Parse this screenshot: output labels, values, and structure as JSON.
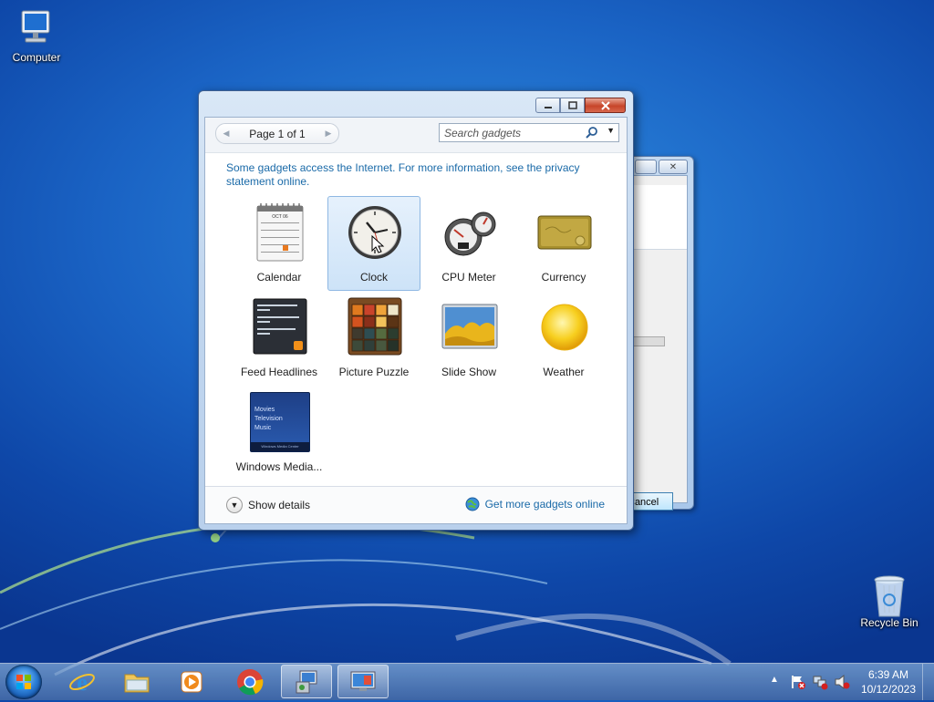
{
  "desktop": {
    "icons": [
      {
        "label": "Computer"
      },
      {
        "label": "Recycle Bin"
      }
    ]
  },
  "window": {
    "pager": {
      "label": "Page 1 of 1"
    },
    "search": {
      "placeholder": "Search gadgets"
    },
    "info_text": "Some gadgets access the Internet.  For more information, see the privacy statement online.",
    "gadgets": [
      {
        "label": "Calendar"
      },
      {
        "label": "Clock"
      },
      {
        "label": "CPU Meter"
      },
      {
        "label": "Currency"
      },
      {
        "label": "Feed Headlines"
      },
      {
        "label": "Picture Puzzle"
      },
      {
        "label": "Slide Show"
      },
      {
        "label": "Weather"
      },
      {
        "label": "Windows Media..."
      }
    ],
    "selected_gadget": "Clock",
    "show_details": "Show details",
    "get_more": "Get more gadgets online"
  },
  "background_dialog": {
    "cancel_label": "Cancel"
  },
  "media_center_tile": {
    "line1": "Movies",
    "line2": "Television",
    "line3": "Music",
    "footer": "Windows Media Center"
  },
  "calendar_tile": {
    "month": "OCT 06"
  },
  "taskbar": {
    "clock_time": "6:39 AM",
    "clock_date": "10/12/2023"
  },
  "colors": {
    "accent_link": "#1a6aa8",
    "selection": "#cde3f8",
    "close_red": "#c7452a"
  }
}
